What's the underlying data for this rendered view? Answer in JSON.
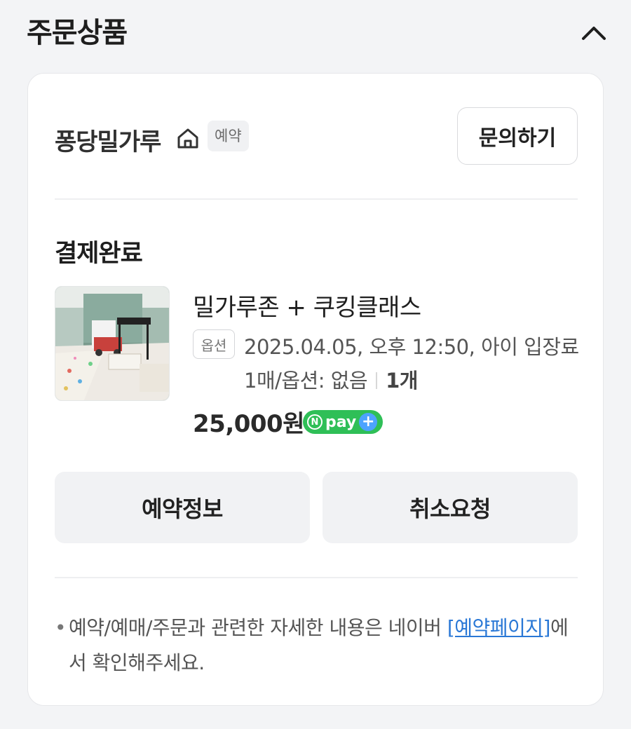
{
  "section": {
    "title": "주문상품"
  },
  "store": {
    "name": "퐁당밀가루",
    "badge": "예약",
    "inquiry_button": "문의하기"
  },
  "order": {
    "status": "결제완료",
    "product_title": "밀가루존 + 쿠킹클래스",
    "option_badge": "옵션",
    "option_line1": "2025.04.05, 오후 12:50, 아이 입장료",
    "option_line2": "1매/옵션: 없음",
    "quantity": "1개",
    "price": "25,000원",
    "npay_label": "pay"
  },
  "actions": {
    "reservation_info": "예약정보",
    "cancel_request": "취소요청"
  },
  "notice": {
    "bullet": "•",
    "text_before": "예약/예매/주문과 관련한 자세한 내용은 네이버 ",
    "link": "[예약페이지]",
    "text_after": "에서 확인해주세요."
  },
  "colors": {
    "npay_green": "#2fbf57",
    "link_blue": "#2a78d6",
    "background": "#f3f4f6"
  }
}
